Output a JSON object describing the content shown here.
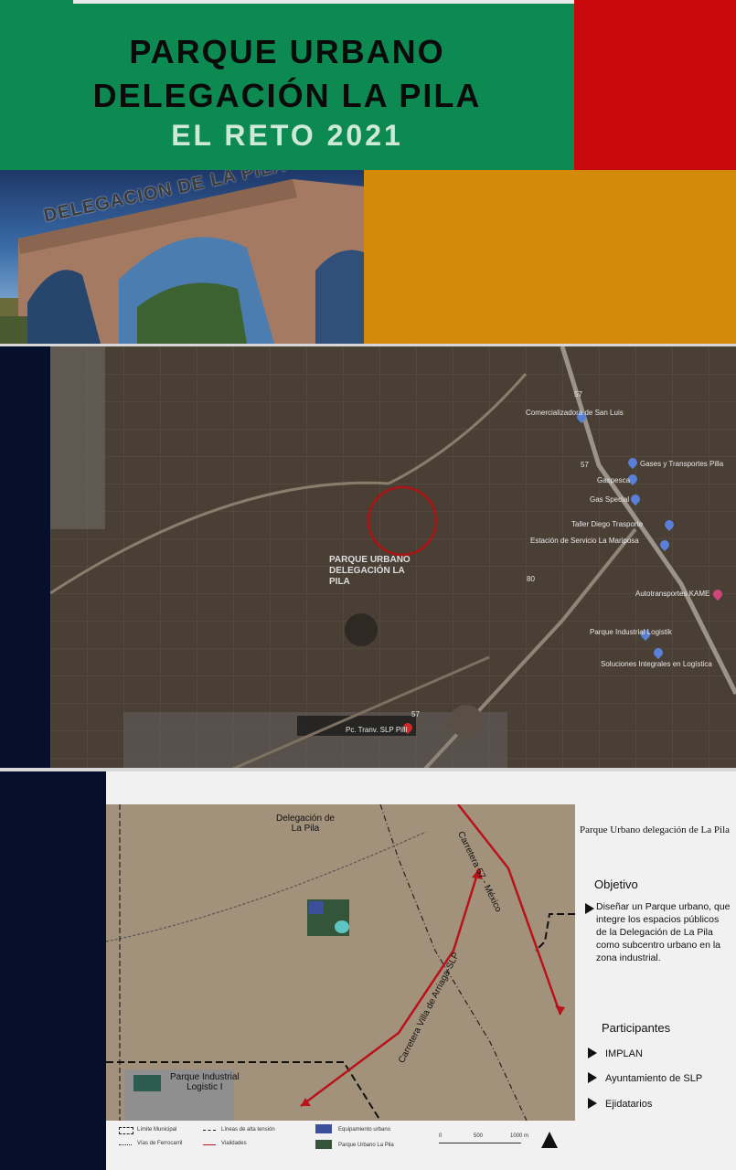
{
  "colors": {
    "green": "#0d8a52",
    "red": "#c8080a",
    "ochre": "#d48a09",
    "navy": "#07102b"
  },
  "header": {
    "line1": "PARQUE URBANO",
    "line2": "DELEGACIÓN LA PILA",
    "line3": "EL RETO 2021"
  },
  "hero": {
    "arch_text": "DELEGACION DE LA PILA"
  },
  "aerial": {
    "park_label": "PARQUE URBANO\nDELEGACIÓN LA\nPILA",
    "pins": [
      "Comercializadora de San Luis",
      "Gases y Transportes Pilla",
      "Gaspesca",
      "Gas Special",
      "Taller Diego Trasporte",
      "Estación de Servicio La Mariposa",
      "Autotransportes KAME",
      "Parque Industrial Logistik",
      "Soluciones Integrales en Logística"
    ],
    "bottom_label": "Pc. Tranv. SLP Pilll",
    "road_numbers": [
      "57",
      "57",
      "80",
      "57"
    ]
  },
  "plan": {
    "labels": {
      "delegacion": "Delegación de\nLa Pila",
      "carretera57": "Carretera 57 - México",
      "carretera_villa": "Carretera Villa de Arriaga-SLP",
      "parque_industrial": "Parque Industrial\nLogistic I"
    },
    "legend": {
      "limite": "Límite Municipal",
      "lineas": "Líneas de alta tensión",
      "equipamiento": "Equipamiento urbano",
      "ferrocarril": "Vías de Ferrocarril",
      "vialidades": "Vialidades",
      "parque": "Parque Urbano La Pila",
      "scale": [
        "0",
        "500",
        "1000 m"
      ]
    }
  },
  "sidebar": {
    "title": "Parque Urbano delegación de La Pila",
    "objetivo_heading": "Objetivo",
    "objetivo_text": "Diseñar un Parque urbano, que integre los espacios públicos de la Delegación de La Pila como subcentro urbano en la zona industrial.",
    "participantes_heading": "Participantes",
    "participantes": [
      "IMPLAN",
      "Ayuntamiento de SLP",
      "Ejidatarios"
    ]
  }
}
